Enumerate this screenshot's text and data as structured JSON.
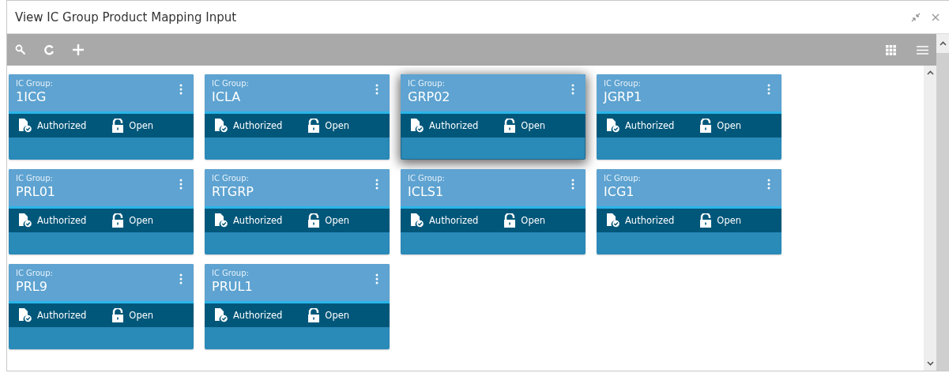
{
  "window": {
    "title": "View IC Group Product Mapping Input"
  },
  "cards": [
    {
      "label": "IC Group:",
      "value": "1ICG",
      "status": "Authorized",
      "state": "Open",
      "selected": false
    },
    {
      "label": "IC Group:",
      "value": "ICLA",
      "status": "Authorized",
      "state": "Open",
      "selected": false
    },
    {
      "label": "IC Group:",
      "value": "GRP02",
      "status": "Authorized",
      "state": "Open",
      "selected": true
    },
    {
      "label": "IC Group:",
      "value": "JGRP1",
      "status": "Authorized",
      "state": "Open",
      "selected": false
    },
    {
      "label": "IC Group:",
      "value": "PRL01",
      "status": "Authorized",
      "state": "Open",
      "selected": false
    },
    {
      "label": "IC Group:",
      "value": "RTGRP",
      "status": "Authorized",
      "state": "Open",
      "selected": false
    },
    {
      "label": "IC Group:",
      "value": "ICLS1",
      "status": "Authorized",
      "state": "Open",
      "selected": false
    },
    {
      "label": "IC Group:",
      "value": "ICG1",
      "status": "Authorized",
      "state": "Open",
      "selected": false
    },
    {
      "label": "IC Group:",
      "value": "PRL9",
      "status": "Authorized",
      "state": "Open",
      "selected": false
    },
    {
      "label": "IC Group:",
      "value": "PRUL1",
      "status": "Authorized",
      "state": "Open",
      "selected": false
    }
  ]
}
